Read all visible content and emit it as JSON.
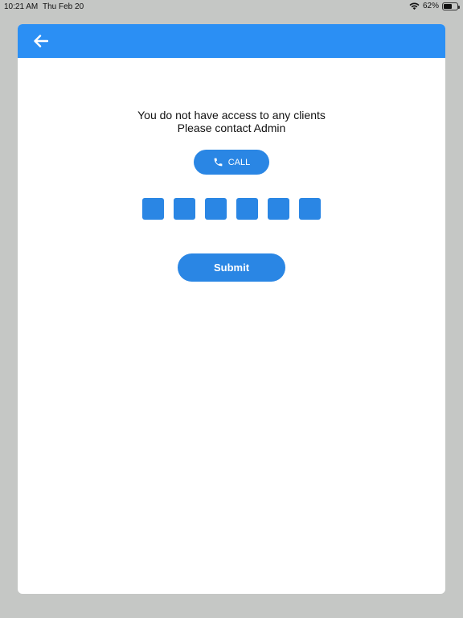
{
  "status_bar": {
    "time": "10:21 AM",
    "date": "Thu Feb 20",
    "battery_percent": "62%",
    "battery_level": 0.62,
    "wifi_icon": "wifi-icon",
    "battery_icon": "battery-icon"
  },
  "header": {
    "back_icon": "arrow-left-icon",
    "color": "#2b8ff4"
  },
  "message": {
    "line1": "You do not have access to any clients",
    "line2": "Please contact Admin"
  },
  "call_button": {
    "label": "CALL",
    "icon": "phone-icon"
  },
  "code_boxes": [
    {
      "value": ""
    },
    {
      "value": ""
    },
    {
      "value": ""
    },
    {
      "value": ""
    },
    {
      "value": ""
    },
    {
      "value": ""
    }
  ],
  "submit_button": {
    "label": "Submit"
  },
  "colors": {
    "accent": "#2a86e4",
    "header": "#2b8ff4",
    "backdrop": "#c5c7c5"
  }
}
